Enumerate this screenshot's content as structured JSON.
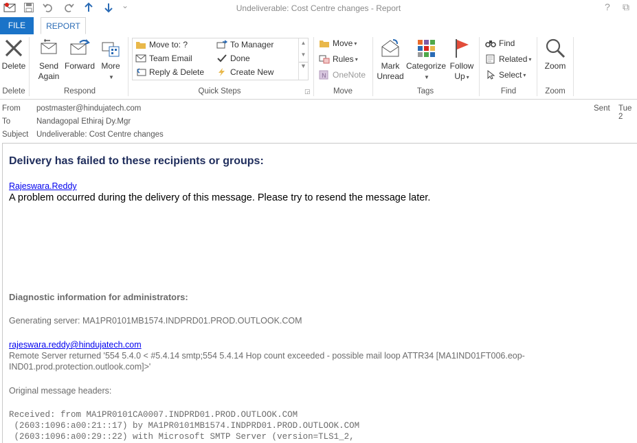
{
  "window": {
    "title": "Undeliverable: Cost Centre changes - Report",
    "help": "?",
    "restore": "⧉",
    "qat_more": "⌄"
  },
  "tabs": {
    "file": "FILE",
    "report": "REPORT"
  },
  "ribbon": {
    "delete": {
      "btn": "Delete",
      "group": "Delete"
    },
    "respond": {
      "send_again_1": "Send",
      "send_again_2": "Again",
      "forward": "Forward",
      "more": "More",
      "group": "Respond"
    },
    "quick_steps": {
      "move_to": "Move to: ?",
      "team_email": "Team Email",
      "reply_delete": "Reply & Delete",
      "to_manager": "To Manager",
      "done": "Done",
      "create_new": "Create New",
      "group": "Quick Steps"
    },
    "move": {
      "move": "Move",
      "rules": "Rules",
      "onenote": "OneNote",
      "group": "Move"
    },
    "tags": {
      "mark_unread_1": "Mark",
      "mark_unread_2": "Unread",
      "categorize": "Categorize",
      "follow_up_1": "Follow",
      "follow_up_2": "Up",
      "group": "Tags"
    },
    "find": {
      "find": "Find",
      "related": "Related",
      "select": "Select",
      "group": "Find"
    },
    "zoom": {
      "btn": "Zoom",
      "group": "Zoom"
    }
  },
  "header": {
    "from_label": "From",
    "from_value": "postmaster@hindujatech.com",
    "to_label": "To",
    "to_value": "Nandagopal Ethiraj Dy.Mgr",
    "subject_label": "Subject",
    "subject_value": "Undeliverable: Cost Centre changes",
    "sent_label": "Sent",
    "sent_value": "Tue 2"
  },
  "body": {
    "title": "Delivery has failed to these recipients or groups:",
    "recipient_link": "Rajeswara.Reddy",
    "problem_text": "A problem occurred during the delivery of this message. Please try to resend the message later.",
    "diag_heading": "Diagnostic information for administrators:",
    "generating_server": "Generating server: MA1PR0101MB1574.INDPRD01.PROD.OUTLOOK.COM",
    "recipient_email": "rajeswara.reddy@hindujatech.com",
    "remote_server_1": "Remote Server returned '554 5.4.0 < #5.4.14 smtp;554 5.4.14 Hop count exceeded - possible mail loop ATTR34 [MA1IND01FT006.eop-",
    "remote_server_2": "IND01.prod.protection.outlook.com]>'",
    "orig_headers": "Original message headers:",
    "hdr_line1": "Received: from MA1PR0101CA0007.INDPRD01.PROD.OUTLOOK.COM",
    "hdr_line2": " (2603:1096:a00:21::17) by MA1PR0101MB1574.INDPRD01.PROD.OUTLOOK.COM",
    "hdr_line3": " (2603:1096:a00:29::22) with Microsoft SMTP Server (version=TLS1_2,"
  }
}
